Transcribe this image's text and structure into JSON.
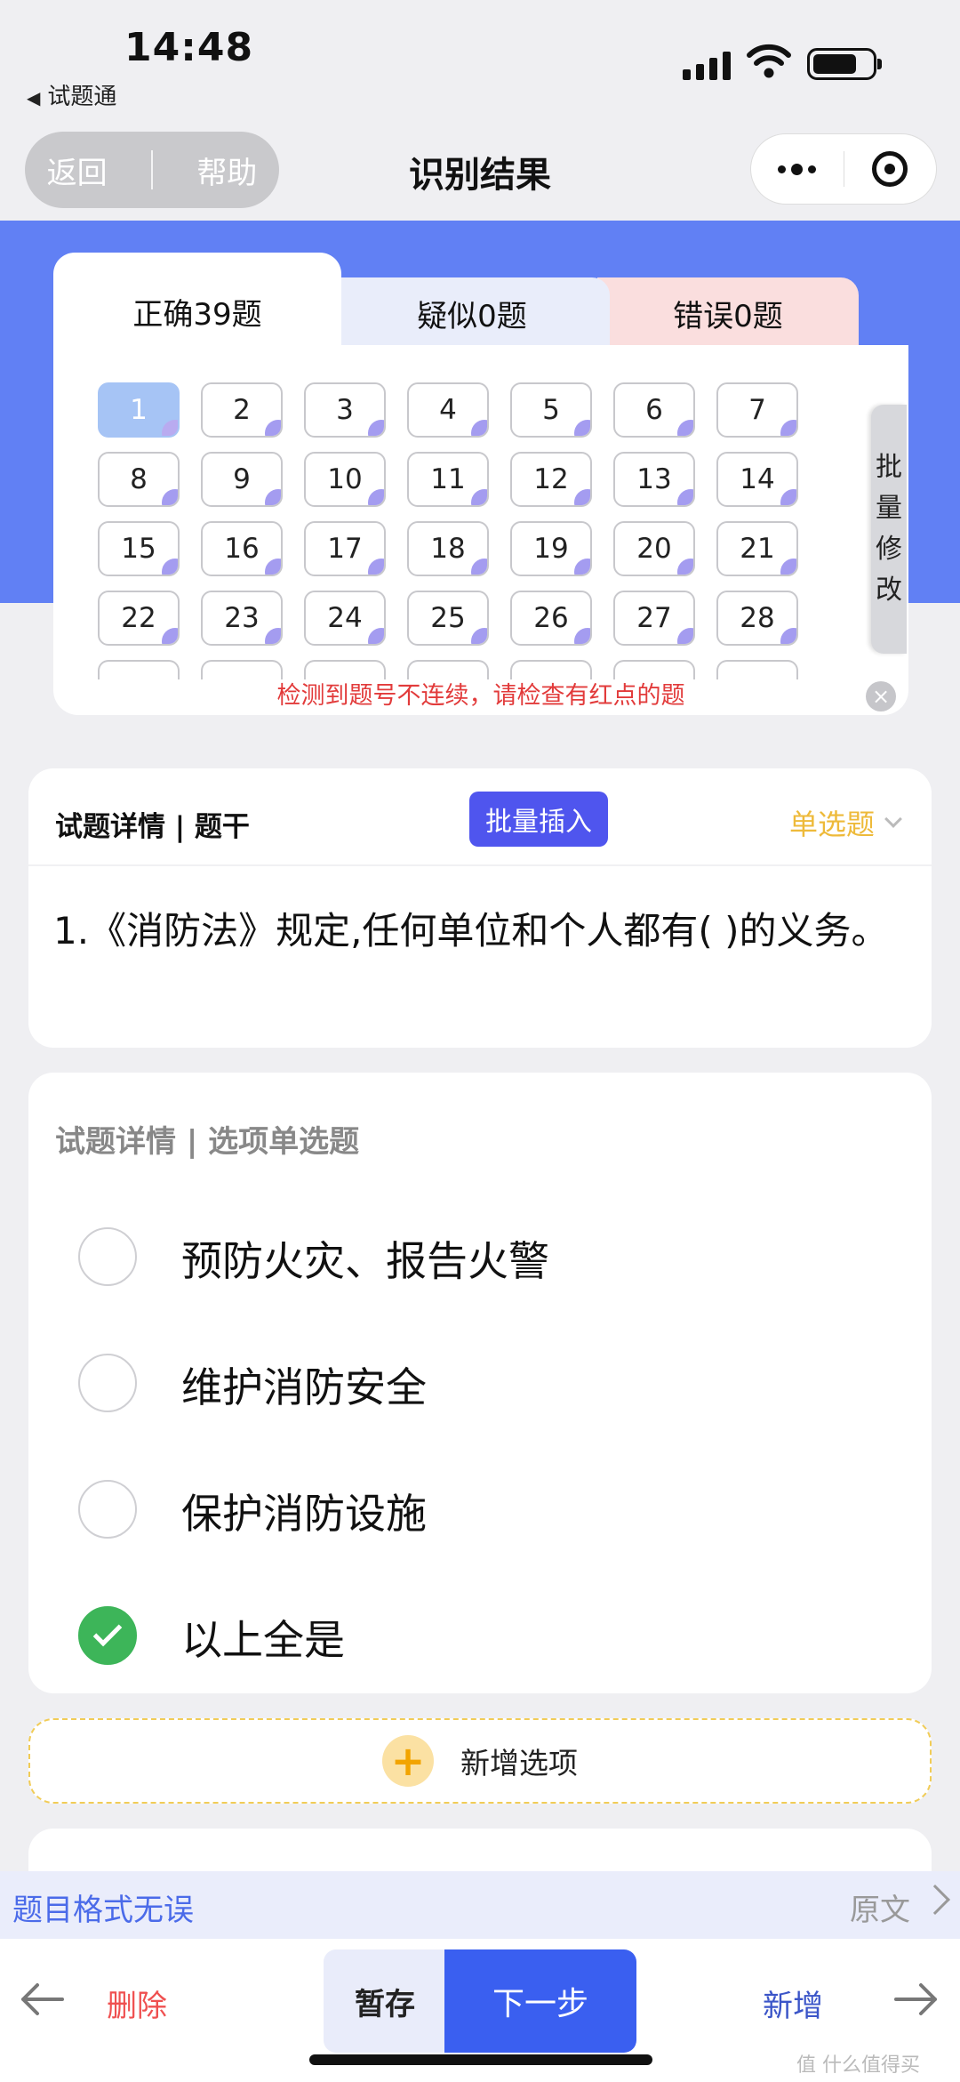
{
  "status_bar": {
    "time": "14:48",
    "back_app": "试题通"
  },
  "nav": {
    "back": "返回",
    "help": "帮助",
    "title": "识别结果"
  },
  "tabs": {
    "correct": "正确39题",
    "suspect": "疑似0题",
    "error": "错误0题"
  },
  "question_numbers": [
    "1",
    "2",
    "3",
    "4",
    "5",
    "6",
    "7",
    "8",
    "9",
    "10",
    "11",
    "12",
    "13",
    "14",
    "15",
    "16",
    "17",
    "18",
    "19",
    "20",
    "21",
    "22",
    "23",
    "24",
    "25",
    "26",
    "27",
    "28"
  ],
  "active_question": "1",
  "batch_edit": "批量修改",
  "warning": "检测到题号不连续，请检查有红点的题",
  "close_glyph": "×",
  "stem": {
    "title": "试题详情 | 题干",
    "insert": "批量插入",
    "type": "单选题",
    "text": "1.《消防法》规定,任何单位和个人都有( )的义务。"
  },
  "options": {
    "title": "试题详情 | 选项单选题",
    "items": [
      {
        "label": "预防火灾、报告火警",
        "checked": false
      },
      {
        "label": "维护消防安全",
        "checked": false
      },
      {
        "label": "保护消防设施",
        "checked": false
      },
      {
        "label": "以上全是",
        "checked": true
      }
    ]
  },
  "add_option": {
    "label": "新增选项",
    "icon": "+"
  },
  "format": {
    "ok": "题目格式无误",
    "original": "原文"
  },
  "toolbar": {
    "delete": "删除",
    "save": "暂存",
    "next": "下一步",
    "add": "新增"
  },
  "watermark": "值 什么值得买"
}
